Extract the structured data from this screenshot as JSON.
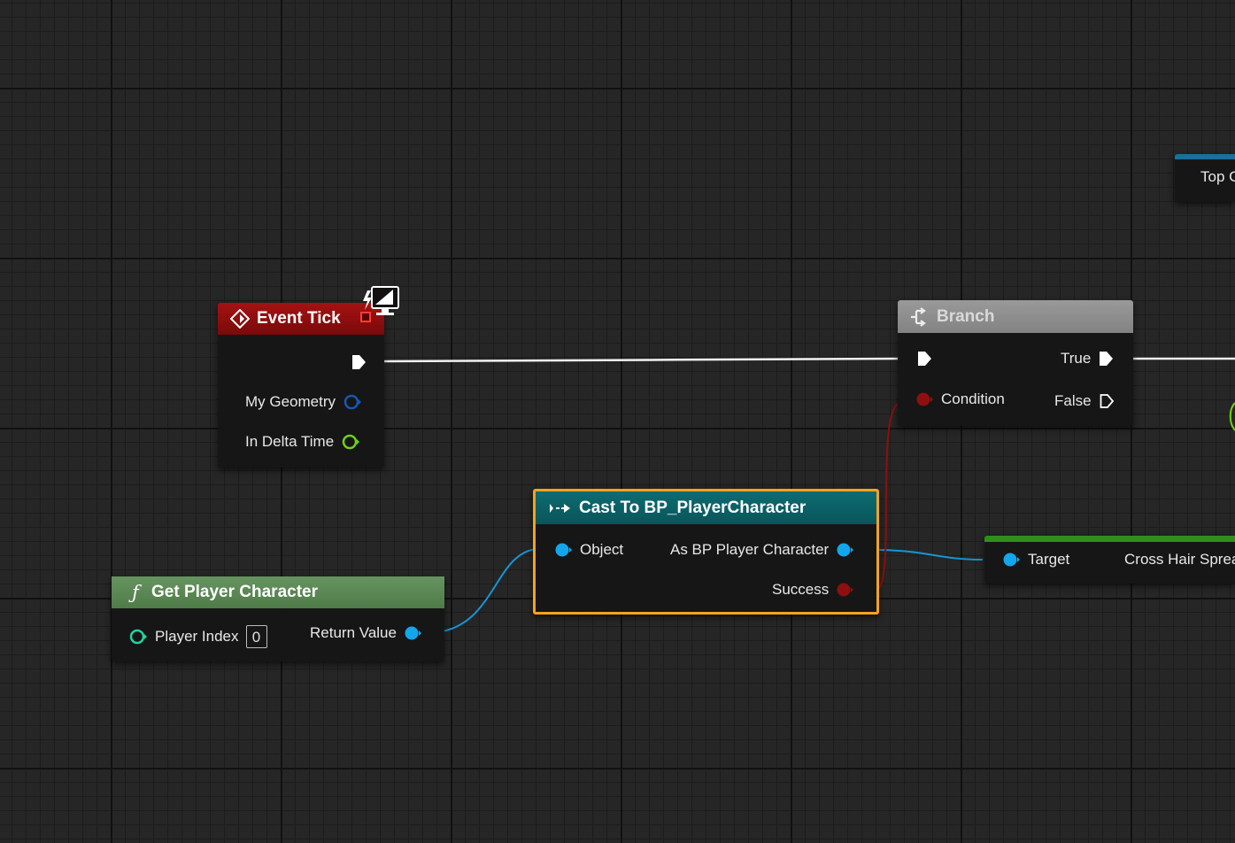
{
  "graph": {
    "event_tick": {
      "title": "Event Tick",
      "pins": {
        "geometry": "My Geometry",
        "delta": "In Delta Time"
      }
    },
    "branch": {
      "title": "Branch",
      "pins": {
        "condition": "Condition",
        "true": "True",
        "false": "False"
      }
    },
    "cast": {
      "title": "Cast To BP_PlayerCharacter",
      "pins": {
        "object": "Object",
        "as": "As BP Player Character",
        "success": "Success"
      }
    },
    "get_player": {
      "title": "Get Player Character",
      "pins": {
        "player_index": "Player Index",
        "player_index_value": "0",
        "return_value": "Return Value"
      }
    },
    "setter": {
      "pins": {
        "target": "Target",
        "cross_hair": "Cross Hair Sprea"
      }
    },
    "top_node": {
      "label": "Top G"
    }
  },
  "colors": {
    "event_header": "#9a0f0f",
    "branch_header": "#8f8f8f",
    "cast_header": "#0b6166",
    "cast_border": "#f2a41e",
    "function_header": "#5c8a55",
    "setter_header": "#2f8f1d",
    "top_header": "#1a6f9c",
    "object_pin": "#13a6ec",
    "struct_pin": "#1657b8",
    "float_pin": "#6fd20f",
    "bool_pin": "#8e0f0f",
    "int_pin": "#1ed69f"
  }
}
